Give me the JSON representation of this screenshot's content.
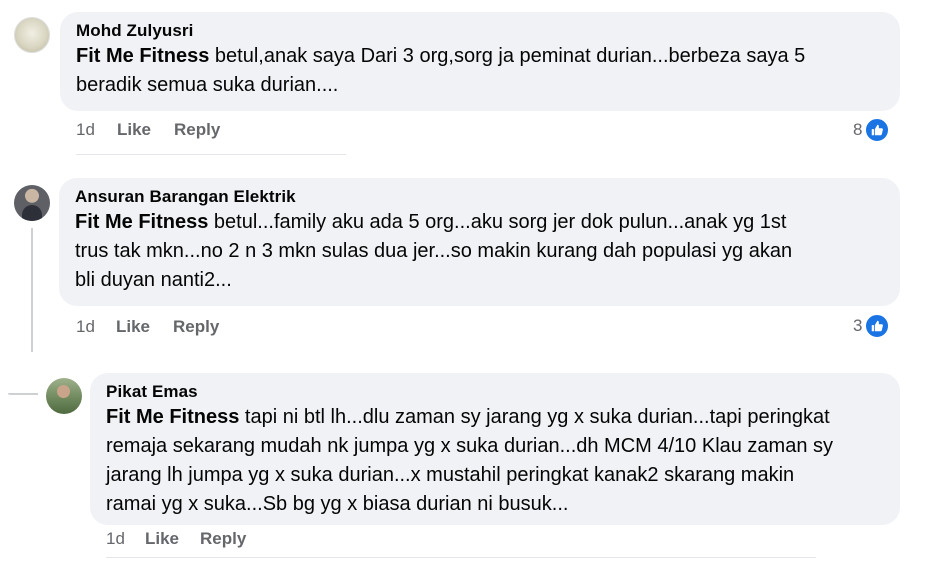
{
  "comments": [
    {
      "author": "Mohd Zulyusri",
      "tag": "Fit Me Fitness",
      "text_lines": [
        " betul,anak saya Dari 3 org,sorg ja peminat durian...berbeza saya 5",
        "beradik semua suka durian...."
      ],
      "time": "1d",
      "like_label": "Like",
      "reply_label": "Reply",
      "reaction_count": "8"
    },
    {
      "author": "Ansuran Barangan Elektrik",
      "tag": "Fit Me Fitness",
      "text_lines": [
        " betul...family aku ada 5 org...aku sorg jer dok pulun...anak yg 1st",
        "trus tak mkn...no 2 n 3 mkn sulas dua jer...so makin kurang dah populasi yg akan",
        "bli duyan nanti2..."
      ],
      "time": "1d",
      "like_label": "Like",
      "reply_label": "Reply",
      "reaction_count": "3"
    },
    {
      "author": "Pikat Emas",
      "tag": "Fit Me Fitness",
      "text_lines": [
        " tapi ni btl lh...dlu zaman sy jarang yg x suka durian...tapi peringkat",
        "remaja sekarang mudah nk jumpa yg x suka durian...dh MCM 4/10 Klau zaman sy",
        "jarang lh jumpa yg x suka durian...x mustahil peringkat kanak2 skarang makin",
        "ramai yg x suka...Sb bg yg x biasa durian ni busuk..."
      ],
      "time": "1d",
      "like_label": "Like",
      "reply_label": "Reply"
    }
  ],
  "colors": {
    "bubble": "#f0f2f5",
    "meta_text": "#65676b",
    "like_blue": "#1b74e4",
    "thread_line": "#ced0d4"
  },
  "icons": {
    "reaction": "like-thumb-icon"
  }
}
